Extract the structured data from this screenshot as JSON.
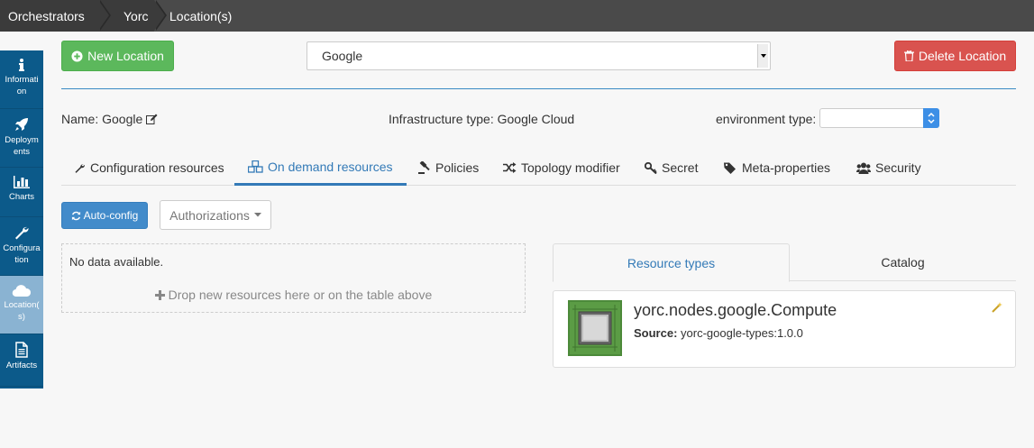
{
  "breadcrumb": [
    "Orchestrators",
    "Yorc",
    "Location(s)"
  ],
  "sidebar": [
    {
      "label": "Informati on",
      "icon": "info-icon"
    },
    {
      "label": "Deploym ents",
      "icon": "rocket-icon"
    },
    {
      "label": "Charts",
      "icon": "bar-chart-icon"
    },
    {
      "label": "Configura tion",
      "icon": "wrench-icon"
    },
    {
      "label": "Location( s)",
      "icon": "cloud-icon"
    },
    {
      "label": "Artifacts",
      "icon": "document-icon"
    }
  ],
  "header": {
    "new_location": "New Location",
    "location_value": "Google",
    "delete_location": "Delete Location"
  },
  "info": {
    "name_label": "Name:",
    "name_value": "Google",
    "infra_label": "Infrastructure type:",
    "infra_value": "Google Cloud",
    "env_label": "environment type:",
    "env_value": ""
  },
  "tabs": [
    {
      "label": "Configuration resources",
      "icon": "wrench-icon"
    },
    {
      "label": "On demand resources",
      "icon": "cubes-icon"
    },
    {
      "label": "Policies",
      "icon": "gavel-icon"
    },
    {
      "label": "Topology modifier",
      "icon": "shuffle-icon"
    },
    {
      "label": "Secret",
      "icon": "key-icon"
    },
    {
      "label": "Meta-properties",
      "icon": "tags-icon"
    },
    {
      "label": "Security",
      "icon": "users-icon"
    }
  ],
  "actions": {
    "auto_config": "Auto-config",
    "authorizations": "Authorizations"
  },
  "dropzone": {
    "no_data": "No data available.",
    "hint": "Drop new resources here or on the table above"
  },
  "resource_tabs": {
    "types": "Resource types",
    "catalog": "Catalog"
  },
  "resource": {
    "name": "yorc.nodes.google.Compute",
    "source_label": "Source:",
    "source_value": "yorc-google-types:1.0.0"
  },
  "colors": {
    "sidebar": "#0c5a8a",
    "sidebar_active": "#8ab3d2",
    "green": "#5cb85c",
    "red": "#d9534f",
    "blue": "#428bca",
    "accent": "#337ab7"
  }
}
